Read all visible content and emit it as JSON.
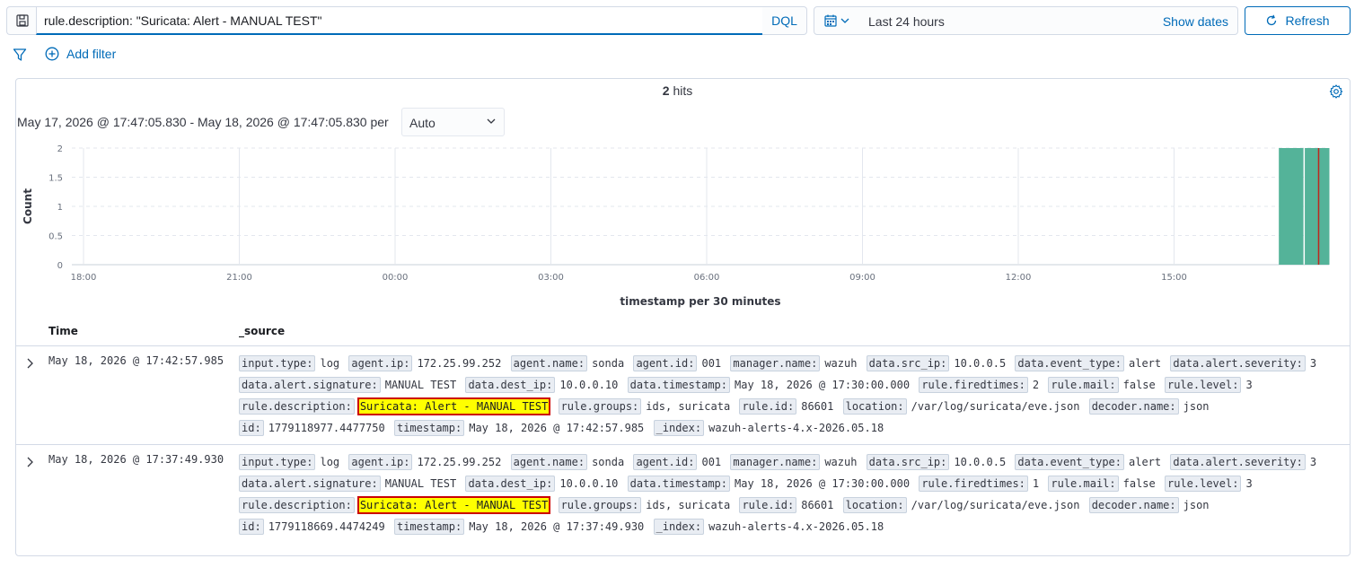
{
  "query": {
    "value": "rule.description: \"Suricata: Alert - MANUAL TEST\"",
    "language": "DQL"
  },
  "date": {
    "range_label": "Last 24 hours",
    "show_dates": "Show dates",
    "refresh": "Refresh"
  },
  "filters": {
    "add_filter": "Add filter"
  },
  "hits": {
    "count": "2",
    "label": "hits"
  },
  "histogram": {
    "range_text": "May 17, 2026 @ 17:47:05.830 - May 18, 2026 @ 17:47:05.830 per",
    "interval": "Auto"
  },
  "chart_data": {
    "type": "bar",
    "xlabel": "timestamp per 30 minutes",
    "ylabel": "Count",
    "y_ticks": [
      "2",
      "1.5",
      "1",
      "0.5",
      "0"
    ],
    "x_ticks": [
      "18:00",
      "21:00",
      "00:00",
      "03:00",
      "06:00",
      "09:00",
      "12:00",
      "15:00"
    ],
    "ylim": [
      0,
      2
    ],
    "grid": true,
    "bars": [
      {
        "x": "17:00",
        "value": 2
      },
      {
        "x": "17:30",
        "value": 2
      }
    ],
    "bar_color": "#54b399",
    "marker_color": "#bd271e"
  },
  "table": {
    "col_time": "Time",
    "col_source": "_source",
    "rows": [
      {
        "time": "May 18, 2026 @ 17:42:57.985",
        "fields": [
          {
            "k": "input.type:",
            "v": "log"
          },
          {
            "k": "agent.ip:",
            "v": "172.25.99.252"
          },
          {
            "k": "agent.name:",
            "v": "sonda"
          },
          {
            "k": "agent.id:",
            "v": "001"
          },
          {
            "k": "manager.name:",
            "v": "wazuh"
          },
          {
            "k": "data.src_ip:",
            "v": "10.0.0.5"
          },
          {
            "k": "data.event_type:",
            "v": "alert"
          },
          {
            "k": "data.alert.severity:",
            "v": "3"
          },
          {
            "k": "data.alert.signature:",
            "v": "MANUAL TEST"
          },
          {
            "k": "data.dest_ip:",
            "v": "10.0.0.10"
          },
          {
            "k": "data.timestamp:",
            "v": "May 18, 2026 @ 17:30:00.000"
          },
          {
            "k": "rule.firedtimes:",
            "v": "2"
          },
          {
            "k": "rule.mail:",
            "v": "false"
          },
          {
            "k": "rule.level:",
            "v": "3"
          },
          {
            "k": "rule.description:",
            "v": "Suricata: Alert - MANUAL TEST",
            "hl": true
          },
          {
            "k": "rule.groups:",
            "v": "ids, suricata"
          },
          {
            "k": "rule.id:",
            "v": "86601"
          },
          {
            "k": "location:",
            "v": "/var/log/suricata/eve.json"
          },
          {
            "k": "decoder.name:",
            "v": "json"
          },
          {
            "k": "id:",
            "v": "1779118977.4477750"
          },
          {
            "k": "timestamp:",
            "v": "May 18, 2026 @ 17:42:57.985"
          },
          {
            "k": "_index:",
            "v": "wazuh-alerts-4.x-2026.05.18"
          }
        ]
      },
      {
        "time": "May 18, 2026 @ 17:37:49.930",
        "fields": [
          {
            "k": "input.type:",
            "v": "log"
          },
          {
            "k": "agent.ip:",
            "v": "172.25.99.252"
          },
          {
            "k": "agent.name:",
            "v": "sonda"
          },
          {
            "k": "agent.id:",
            "v": "001"
          },
          {
            "k": "manager.name:",
            "v": "wazuh"
          },
          {
            "k": "data.src_ip:",
            "v": "10.0.0.5"
          },
          {
            "k": "data.event_type:",
            "v": "alert"
          },
          {
            "k": "data.alert.severity:",
            "v": "3"
          },
          {
            "k": "data.alert.signature:",
            "v": "MANUAL TEST"
          },
          {
            "k": "data.dest_ip:",
            "v": "10.0.0.10"
          },
          {
            "k": "data.timestamp:",
            "v": "May 18, 2026 @ 17:30:00.000"
          },
          {
            "k": "rule.firedtimes:",
            "v": "1"
          },
          {
            "k": "rule.mail:",
            "v": "false"
          },
          {
            "k": "rule.level:",
            "v": "3"
          },
          {
            "k": "rule.description:",
            "v": "Suricata: Alert - MANUAL TEST",
            "hl": true
          },
          {
            "k": "rule.groups:",
            "v": "ids, suricata"
          },
          {
            "k": "rule.id:",
            "v": "86601"
          },
          {
            "k": "location:",
            "v": "/var/log/suricata/eve.json"
          },
          {
            "k": "decoder.name:",
            "v": "json"
          },
          {
            "k": "id:",
            "v": "1779118669.4474249"
          },
          {
            "k": "timestamp:",
            "v": "May 18, 2026 @ 17:37:49.930"
          },
          {
            "k": "_index:",
            "v": "wazuh-alerts-4.x-2026.05.18"
          }
        ]
      }
    ]
  }
}
